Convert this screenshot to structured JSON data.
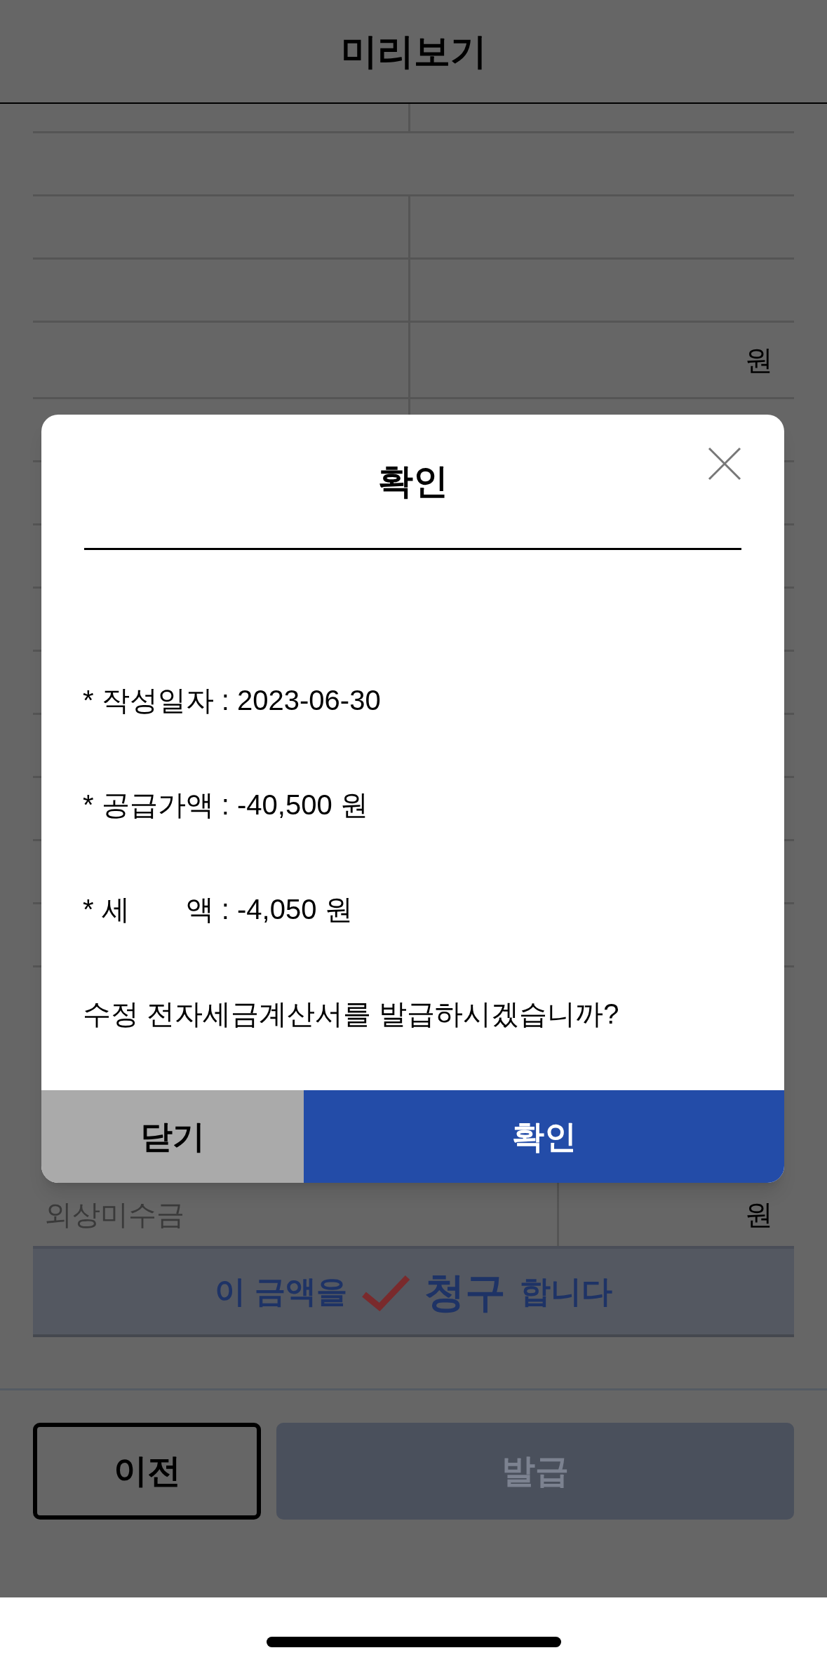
{
  "header": {
    "title": "미리보기"
  },
  "table": {
    "rows": [
      {
        "kind": "split"
      },
      {
        "kind": "full"
      },
      {
        "kind": "split"
      },
      {
        "kind": "split"
      },
      {
        "kind": "split",
        "unit": "원"
      },
      {
        "kind": "split"
      },
      {
        "kind": "split"
      },
      {
        "kind": "split"
      },
      {
        "kind": "split"
      },
      {
        "kind": "split"
      },
      {
        "kind": "split"
      },
      {
        "kind": "full"
      },
      {
        "kind": "split"
      },
      {
        "kind": "split"
      }
    ]
  },
  "receivable_row": {
    "label": "외상미수금",
    "unit": "원"
  },
  "claim": {
    "before": "이 금액을",
    "checked": true,
    "emphasis": "청구",
    "after": "합니다"
  },
  "footer_buttons": [
    {
      "label": "이전",
      "kind": "outline",
      "disabled": false
    },
    {
      "label": "발급",
      "kind": "primary",
      "disabled": true
    }
  ],
  "dialog": {
    "title": "확인",
    "lines": [
      "* 작성일자 : 2023-06-30",
      "* 공급가액 : -40,500 원",
      "* 세　　액 : -4,050 원"
    ],
    "question": "수정 전자세금계산서를 발급하시겠습니까?",
    "buttons": [
      {
        "label": "닫기",
        "kind": "secondary"
      },
      {
        "label": "확인",
        "kind": "primary"
      }
    ]
  }
}
